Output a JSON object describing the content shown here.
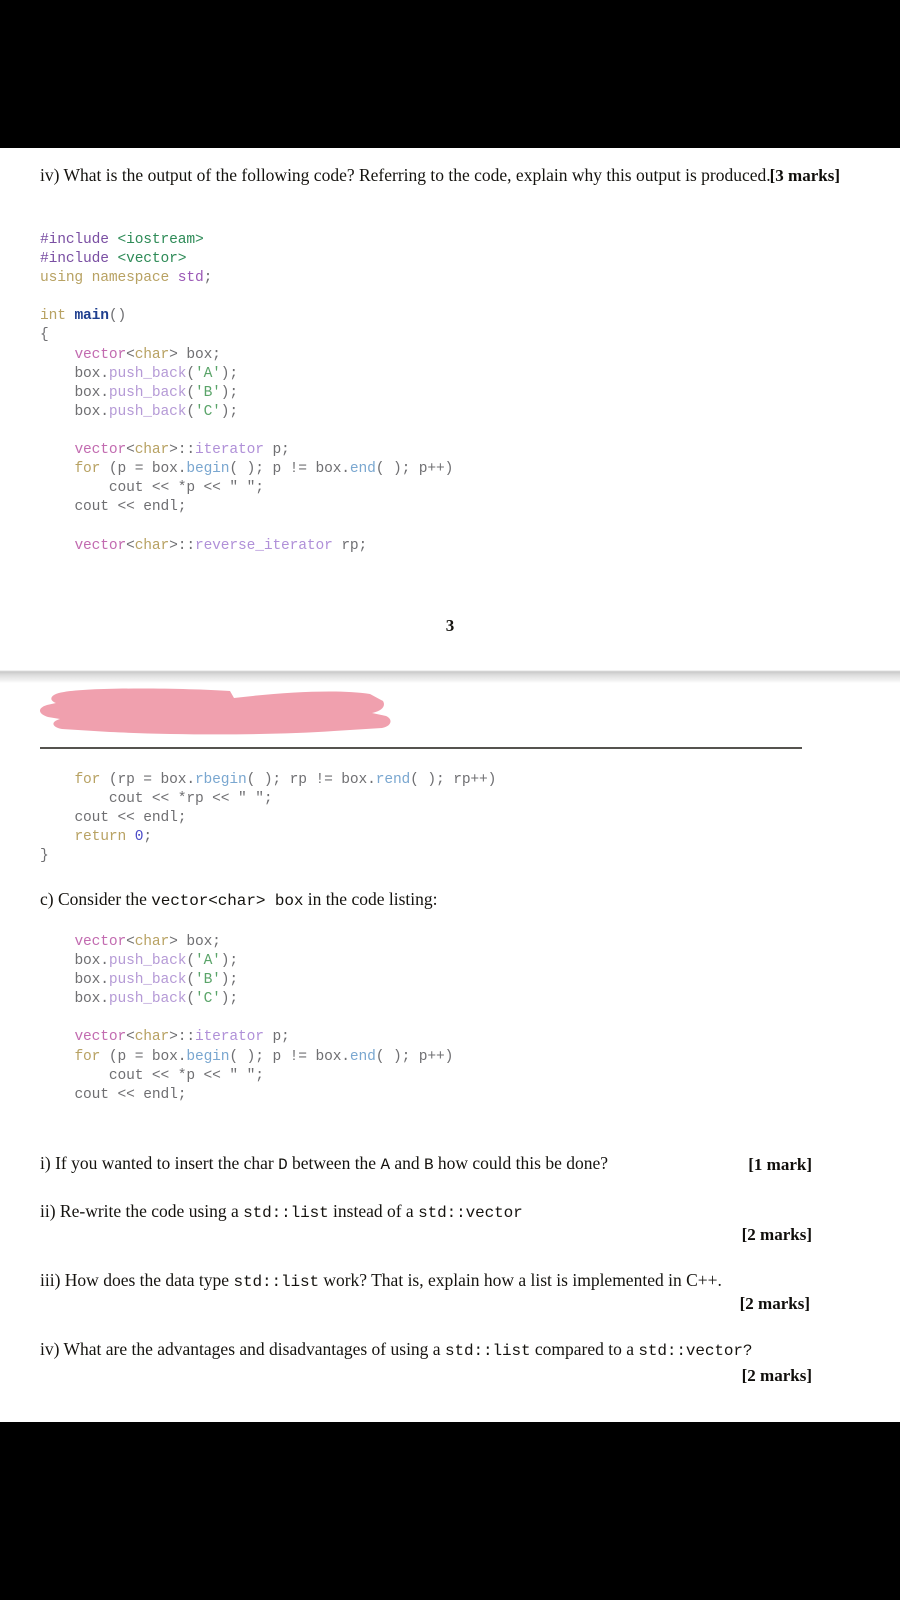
{
  "document": {
    "kind": "scanned-exam-paper",
    "page_number": "3",
    "colors": {
      "letterbox": "#000000",
      "paper": "#ffffff",
      "redaction_pink": "#f0a0ae",
      "rule": "#55534f",
      "body_text": "#15130f"
    }
  },
  "page_one": {
    "question_iv": {
      "text": "iv) What is the output of the following code? Referring to the code, explain why this output is produced.",
      "marks": "[3 marks]"
    },
    "code_listing": {
      "lines": [
        "#include <iostream>",
        "#include <vector>",
        "using namespace std;",
        "",
        "int main()",
        "{",
        "    vector<char> box;",
        "    box.push_back('A');",
        "    box.push_back('B');",
        "    box.push_back('C');",
        "",
        "    vector<char>::iterator p;",
        "    for (p = box.begin( ); p != box.end( ); p++)",
        "        cout << *p << \" \";",
        "    cout << endl;",
        "",
        "    vector<char>::reverse_iterator rp;"
      ]
    }
  },
  "page_two": {
    "redaction": {
      "label": "pink-marker-redaction",
      "color": "#f0a0ae"
    },
    "code_continuation": {
      "lines": [
        "    for (rp = box.rbegin( ); rp != box.rend( ); rp++)",
        "        cout << *rp << \" \";",
        "    cout << endl;",
        "    return 0;",
        "}"
      ]
    },
    "question_c": {
      "lead_before": "c) Consider the ",
      "lead_code": "vector<char>  box",
      "lead_after": " in the code listing:"
    },
    "code_listing_2": {
      "lines": [
        "    vector<char> box;",
        "    box.push_back('A');",
        "    box.push_back('B');",
        "    box.push_back('C');",
        "",
        "    vector<char>::iterator p;",
        "    for (p = box.begin( ); p != box.end( ); p++)",
        "        cout << *p << \" \";",
        "    cout << endl;"
      ]
    },
    "sub_questions": [
      {
        "id": "i",
        "segments": [
          {
            "t": "i) If you wanted to insert the char ",
            "mono": false
          },
          {
            "t": "D",
            "mono": true
          },
          {
            "t": " between the ",
            "mono": false
          },
          {
            "t": "A",
            "mono": true
          },
          {
            "t": " and ",
            "mono": false
          },
          {
            "t": "B",
            "mono": true
          },
          {
            "t": " how could this be done?",
            "mono": false
          }
        ],
        "marks": "[1 mark]"
      },
      {
        "id": "ii",
        "segments": [
          {
            "t": "ii) Re-write the code using a ",
            "mono": false
          },
          {
            "t": "std::list",
            "mono": true
          },
          {
            "t": " instead of a ",
            "mono": false
          },
          {
            "t": "std::vector",
            "mono": true
          }
        ],
        "marks": "[2 marks]"
      },
      {
        "id": "iii",
        "segments": [
          {
            "t": "iii) How does the data type ",
            "mono": false
          },
          {
            "t": "std::list",
            "mono": true
          },
          {
            "t": " work? That is, explain how a list is implemented in C++.",
            "mono": false
          }
        ],
        "marks": "[2 marks]"
      },
      {
        "id": "iv",
        "segments": [
          {
            "t": "iv) What are the advantages and disadvantages of using a ",
            "mono": false
          },
          {
            "t": "std::list",
            "mono": true
          },
          {
            "t": " compared to a ",
            "mono": false
          },
          {
            "t": "std::vector?",
            "mono": true
          }
        ],
        "marks": "[2 marks]"
      }
    ]
  }
}
